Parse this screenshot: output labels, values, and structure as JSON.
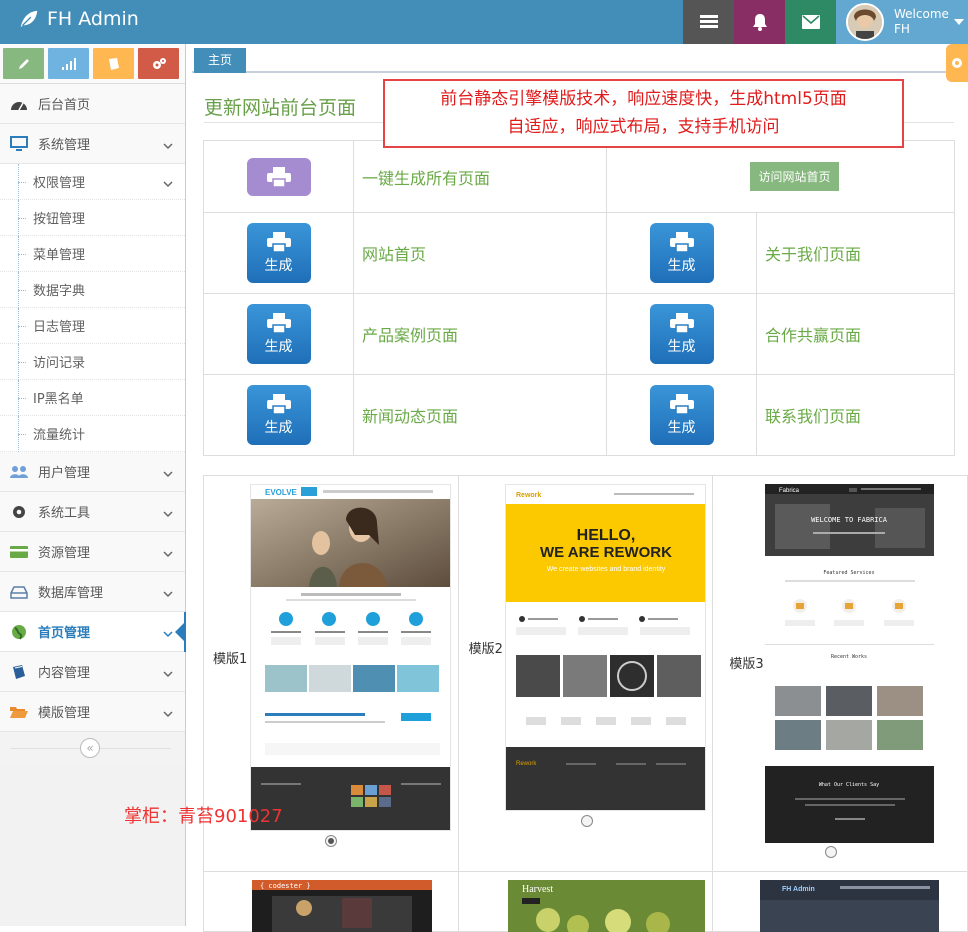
{
  "navbar": {
    "brand": "FH Admin",
    "user_welcome": "Welcome",
    "user_name": "FH",
    "icons": [
      "leaf-icon",
      "tasks-icon",
      "bell-icon",
      "envelope-icon"
    ]
  },
  "sidebar": {
    "shortcuts": [
      "pencil-icon",
      "signal-icon",
      "book-icon",
      "cogs-icon"
    ],
    "home": "后台首页",
    "system": "系统管理",
    "sub": [
      "权限管理",
      "按钮管理",
      "菜单管理",
      "数据字典",
      "日志管理",
      "访问记录",
      "IP黑名单",
      "流量统计"
    ],
    "items": [
      "用户管理",
      "系统工具",
      "资源管理",
      "数据库管理",
      "首页管理",
      "内容管理",
      "模版管理"
    ],
    "collapse": "«"
  },
  "tabs": {
    "home": "主页"
  },
  "main": {
    "title": "更新网站前台页面",
    "notice_line1": "前台静态引擎模版技术，响应速度快，生成html5页面",
    "notice_line2": "自适应，响应式布局，支持手机访问",
    "gen_all": "一键生成所有页面",
    "visit": "访问网站首页",
    "gen_label": "生成",
    "pages": [
      "网站首页",
      "关于我们页面",
      "产品案例页面",
      "合作共赢页面",
      "新闻动态页面",
      "联系我们页面"
    ]
  },
  "templates": {
    "labels": [
      "模版1",
      "模版2",
      "模版3"
    ],
    "selected": 1,
    "t1": {
      "logo": "EVOLVE"
    },
    "t2": {
      "logo": "Rework",
      "hero1": "HELLO,",
      "hero2": "WE ARE REWORK",
      "hero3": "We create websites and brand identity"
    },
    "t3": {
      "logo": "Fabrica",
      "hero": "WELCOME TO FABRICA",
      "section": "Featured Services",
      "works": "Recent Works",
      "clients": "What Our Clients Say"
    },
    "row2": [
      "{ codester }",
      "Harvest",
      "FH Admin"
    ]
  },
  "watermark": "掌柜：青苔901027",
  "colors": {
    "navbar": "#438eb9",
    "accent": "#2b7dbc",
    "green_text": "#69aa46",
    "notice_red": "#e01b1b"
  }
}
